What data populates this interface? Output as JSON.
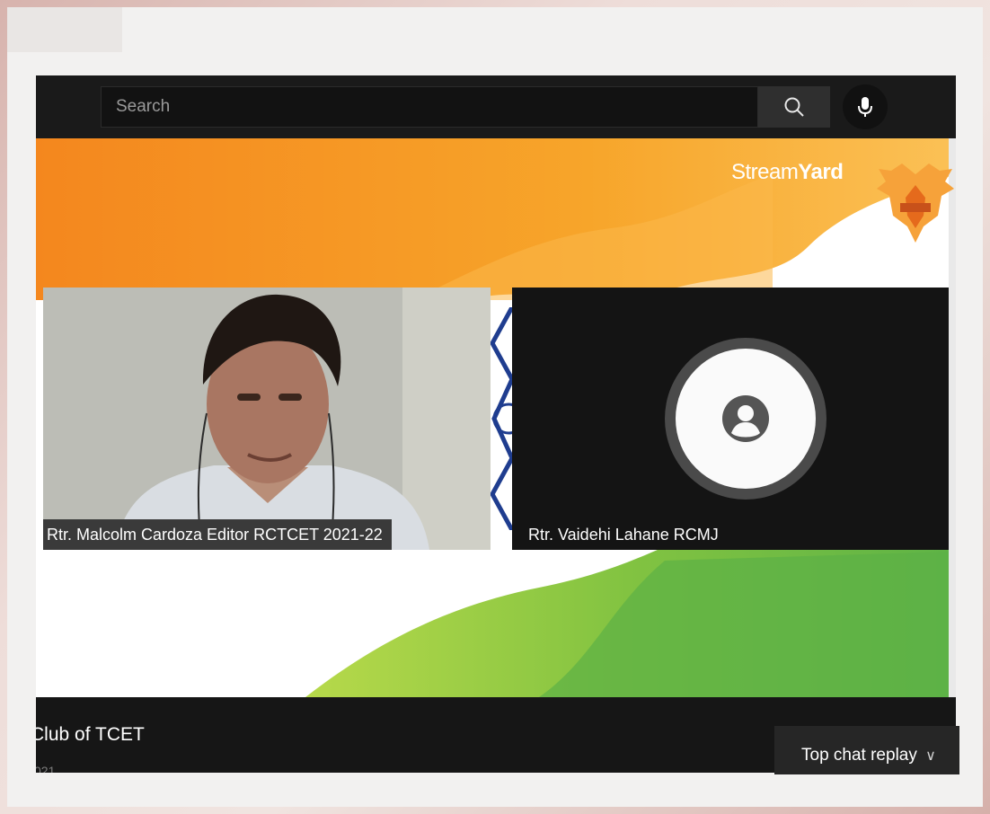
{
  "search": {
    "placeholder": "Search"
  },
  "icons": {
    "search": "search-icon",
    "mic": "mic-icon",
    "avatar": "person-icon",
    "chevron": "chevron-down-icon"
  },
  "stage": {
    "brand_prefix": "Stream",
    "brand_suffix": "Yard",
    "participants": [
      {
        "name": "Rtr. Malcolm Cardoza Editor RCTCET 2021-22"
      },
      {
        "name": "Rtr. Vaidehi Lahane RCMJ"
      }
    ]
  },
  "video_info": {
    "channel_fragment": "Club of TCET",
    "date_fragment": "021"
  },
  "chat": {
    "label": "Top chat replay",
    "chevron": "∨"
  },
  "colors": {
    "orange": "#f7941d",
    "green": "#6cbd45",
    "dark": "#1a1a1a"
  }
}
